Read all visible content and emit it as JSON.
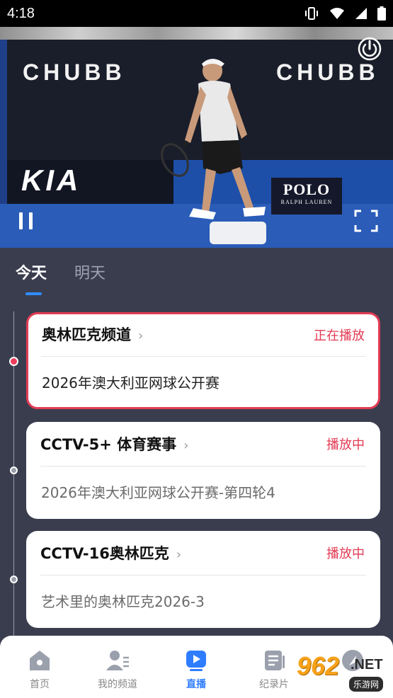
{
  "status_bar": {
    "time": "4:18",
    "icons": [
      "vibrate-icon",
      "wifi-icon",
      "signal-icon",
      "battery-icon"
    ]
  },
  "video": {
    "board_text_left": "CHUBB",
    "board_text_right": "CHUBB",
    "sponsor_left": "KIA",
    "sponsor_polo": "POLO",
    "sponsor_polo_sub": "RALPH LAUREN",
    "controls": [
      "power-icon",
      "pause-icon",
      "fullscreen-icon"
    ]
  },
  "tabs": [
    {
      "label": "今天",
      "active": true
    },
    {
      "label": "明天",
      "active": false
    }
  ],
  "schedule": [
    {
      "channel": "奥林匹克频道",
      "status": "正在播放",
      "program": "2026年澳大利亚网球公开赛",
      "active": true
    },
    {
      "channel": "CCTV-5+ 体育赛事",
      "status": "播放中",
      "program": "2026年澳大利亚网球公开赛-第四轮4",
      "active": false
    },
    {
      "channel": "CCTV-16奥林匹克",
      "status": "播放中",
      "program": "艺术里的奥林匹克2026-3",
      "active": false
    }
  ],
  "bottom_nav": [
    {
      "label": "首页",
      "icon": "home-icon",
      "active": false
    },
    {
      "label": "我的频道",
      "icon": "my-channels-icon",
      "active": false
    },
    {
      "label": "直播",
      "icon": "live-play-icon",
      "active": true
    },
    {
      "label": "纪录片",
      "icon": "documentary-icon",
      "active": false
    },
    {
      "label": "",
      "icon": "rocket-icon",
      "active": false
    }
  ],
  "watermark": {
    "number": "962",
    "suffix": ".NET",
    "tag": "乐游网"
  },
  "colors": {
    "accent_blue": "#2f8cff",
    "live_red": "#e23b54",
    "page_bg": "#3a3d4e"
  }
}
